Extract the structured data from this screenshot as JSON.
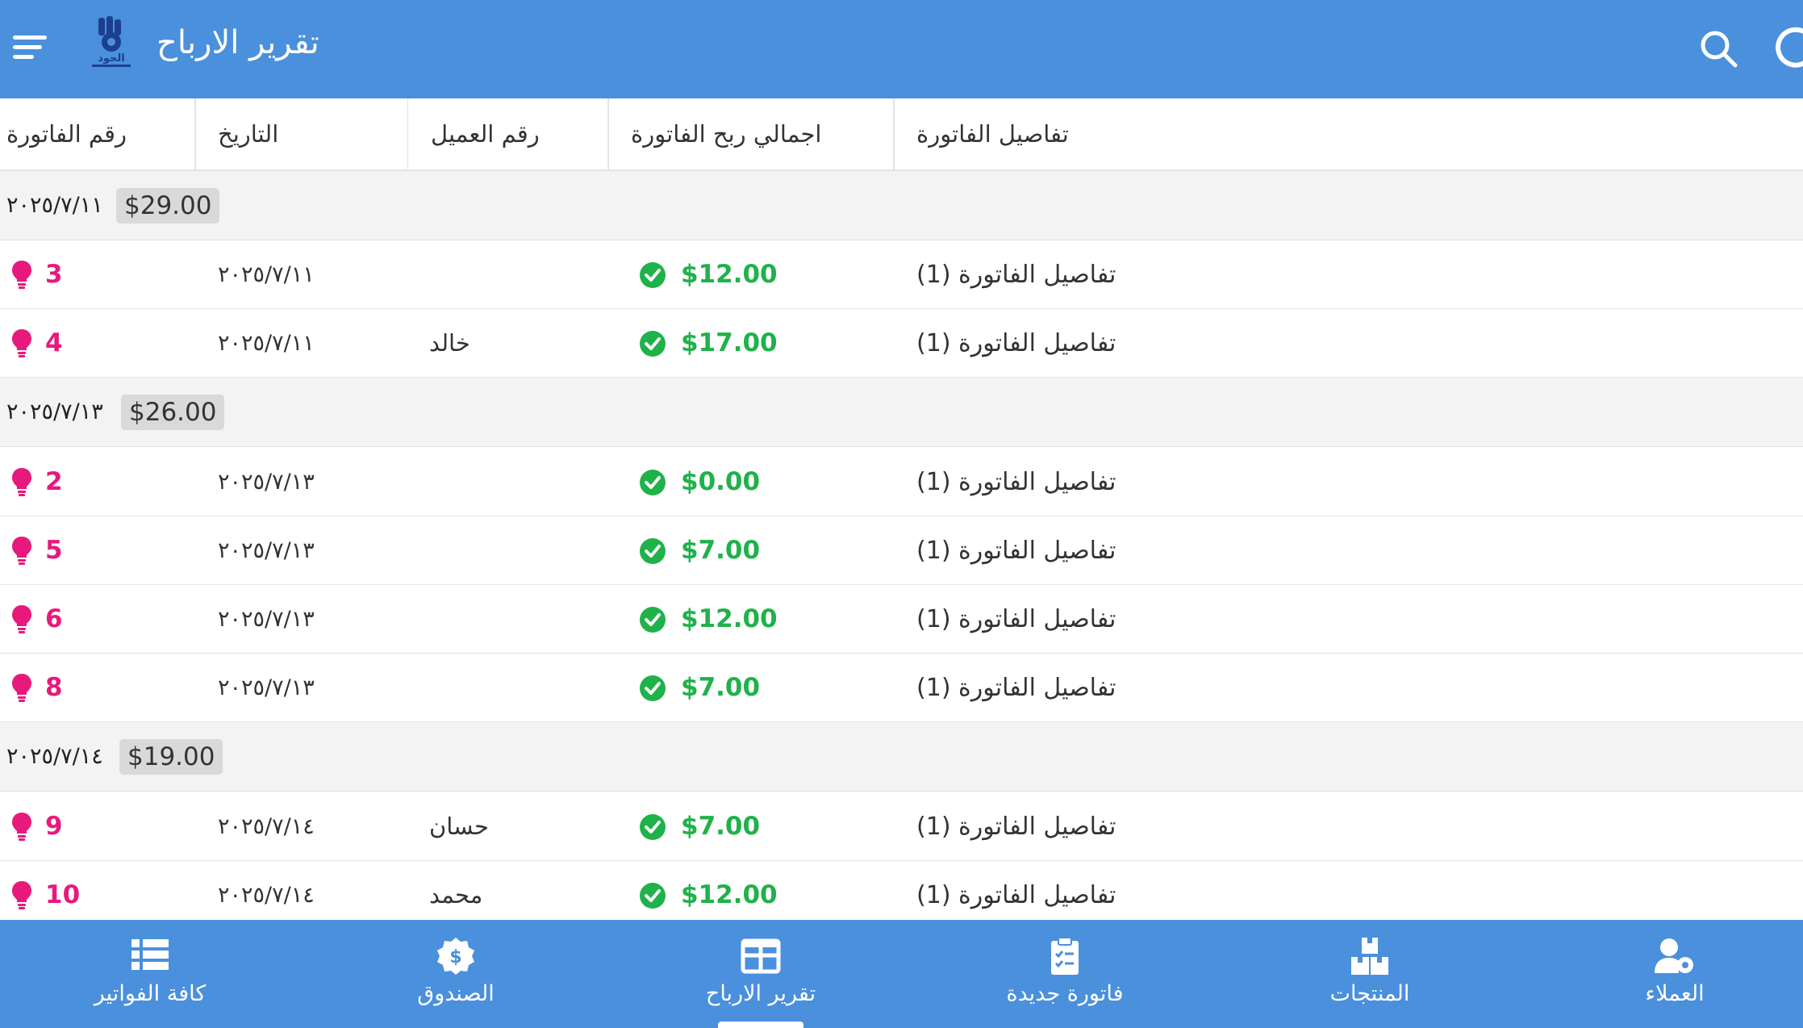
{
  "appbar": {
    "title": "تقرير الارباح",
    "logo_text": "الجود"
  },
  "columns": {
    "invoice_number": "رقم الفاتورة",
    "date": "التاريخ",
    "customer_number": "رقم العميل",
    "total_profit": "اجمالي ربح الفاتورة",
    "details": "تفاصيل الفاتورة"
  },
  "groups": [
    {
      "date": "٢٠٢٥/٧/١١",
      "total": "$29.00",
      "rows": [
        {
          "number": "3",
          "date": "٢٠٢٥/٧/١١",
          "customer": "",
          "amount": "$12.00",
          "details": "تفاصيل الفاتورة (1)"
        },
        {
          "number": "4",
          "date": "٢٠٢٥/٧/١١",
          "customer": "خالد",
          "amount": "$17.00",
          "details": "تفاصيل الفاتورة (1)"
        }
      ]
    },
    {
      "date": "٢٠٢٥/٧/١٣",
      "total": "$26.00",
      "rows": [
        {
          "number": "2",
          "date": "٢٠٢٥/٧/١٣",
          "customer": "",
          "amount": "$0.00",
          "details": "تفاصيل الفاتورة (1)"
        },
        {
          "number": "5",
          "date": "٢٠٢٥/٧/١٣",
          "customer": "",
          "amount": "$7.00",
          "details": "تفاصيل الفاتورة (1)"
        },
        {
          "number": "6",
          "date": "٢٠٢٥/٧/١٣",
          "customer": "",
          "amount": "$12.00",
          "details": "تفاصيل الفاتورة (1)"
        },
        {
          "number": "8",
          "date": "٢٠٢٥/٧/١٣",
          "customer": "",
          "amount": "$7.00",
          "details": "تفاصيل الفاتورة (1)"
        }
      ]
    },
    {
      "date": "٢٠٢٥/٧/١٤",
      "total": "$19.00",
      "rows": [
        {
          "number": "9",
          "date": "٢٠٢٥/٧/١٤",
          "customer": "حسان",
          "amount": "$7.00",
          "details": "تفاصيل الفاتورة (1)"
        },
        {
          "number": "10",
          "date": "٢٠٢٥/٧/١٤",
          "customer": "محمد",
          "amount": "$12.00",
          "details": "تفاصيل الفاتورة (1)"
        }
      ]
    }
  ],
  "bottom_nav": {
    "all_invoices": "كافة الفواتير",
    "cashbox": "الصندوق",
    "profit_report": "تقرير الارباح",
    "new_invoice": "فاتورة جديدة",
    "products": "المنتجات",
    "customers": "العملاء"
  },
  "colors": {
    "primary": "#4a90dd",
    "invoice_number": "#e8197d",
    "amount": "#1fb24a"
  }
}
